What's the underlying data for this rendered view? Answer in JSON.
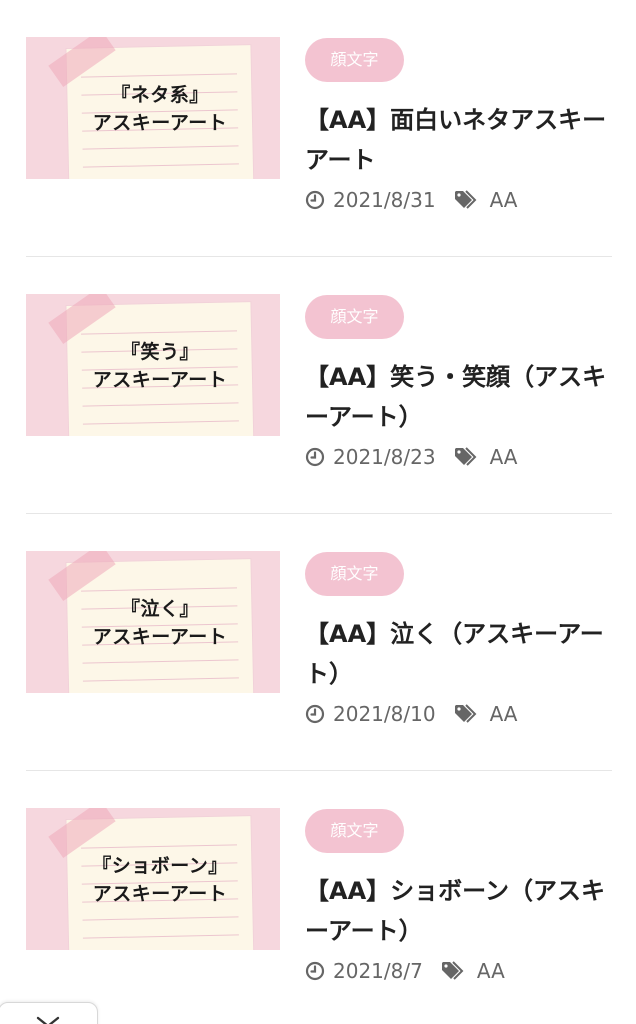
{
  "posts": [
    {
      "thumb_line1": "『ネタ系』",
      "thumb_line2": "アスキーアート",
      "category": "顔文字",
      "title": "【AA】面白いネタアスキーアート",
      "date": "2021/8/31",
      "tag": "AA"
    },
    {
      "thumb_line1": "『笑う』",
      "thumb_line2": "アスキーアート",
      "category": "顔文字",
      "title": "【AA】笑う・笑顔（アスキーアート）",
      "date": "2021/8/23",
      "tag": "AA"
    },
    {
      "thumb_line1": "『泣く』",
      "thumb_line2": "アスキーアート",
      "category": "顔文字",
      "title": "【AA】泣く（アスキーアート）",
      "date": "2021/8/10",
      "tag": "AA"
    },
    {
      "thumb_line1": "『ショボーン』",
      "thumb_line2": "アスキーアート",
      "category": "顔文字",
      "title": "【AA】ショボーン（アスキーアート）",
      "date": "2021/8/7",
      "tag": "AA"
    }
  ],
  "icons": {
    "date": "clock-icon",
    "tag": "tag-icon",
    "bottom_tab": "chevron-down-icon"
  },
  "colors": {
    "category_badge": "#f3c3d1",
    "thumb_background": "#f6d7de",
    "thumb_paper": "#fdf7e8",
    "meta_text": "#666666"
  }
}
